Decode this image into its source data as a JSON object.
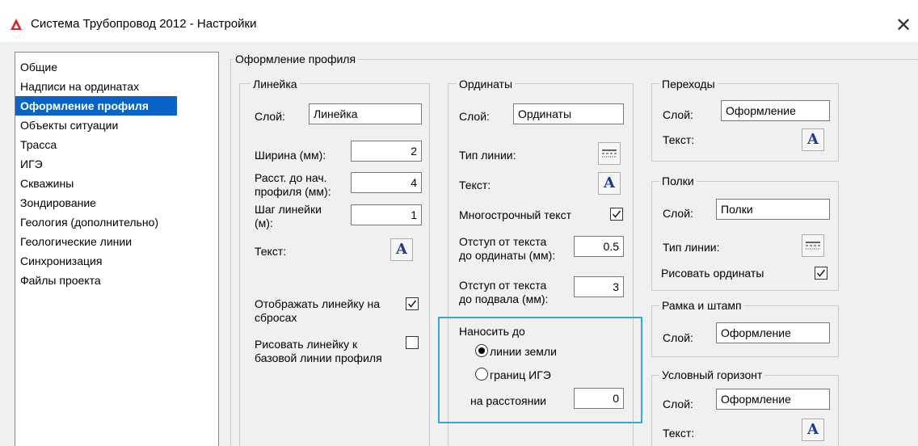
{
  "window": {
    "title": "Система Трубопровод 2012 - Настройки",
    "close_symbol": "✕"
  },
  "sidebar": {
    "items": [
      {
        "label": "Общие"
      },
      {
        "label": "Надписи на ординатах"
      },
      {
        "label": "Оформление профиля",
        "selected": true
      },
      {
        "label": "Объекты ситуации"
      },
      {
        "label": "Трасса"
      },
      {
        "label": "ИГЭ"
      },
      {
        "label": "Скважины"
      },
      {
        "label": "Зондирование"
      },
      {
        "label": "Геология (дополнительно)"
      },
      {
        "label": "Геологические линии"
      },
      {
        "label": "Синхронизация"
      },
      {
        "label": "Файлы проекта"
      }
    ]
  },
  "main": {
    "group_label": "Оформление профиля",
    "lineyka": {
      "label": "Линейка",
      "layer_label": "Слой:",
      "layer_value": "Линейка",
      "width_label": "Ширина (мм):",
      "width_value": "2",
      "dist_label_1": "Расст. до нач.",
      "dist_label_2": "профиля (мм):",
      "dist_value": "4",
      "step_label_1": "Шаг линейки",
      "step_label_2": "(м):",
      "step_value": "1",
      "text_label": "Текст:",
      "text_button": "A",
      "show_label_1": "Отображать линейку на",
      "show_label_2": "сбросах",
      "show_checked": true,
      "draw_label_1": "Рисовать линейку к",
      "draw_label_2": "базовой линии профиля",
      "draw_checked": false
    },
    "ordinaty": {
      "label": "Ординаты",
      "layer_label": "Слой:",
      "layer_value": "Ординаты",
      "linetype_label": "Тип линии:",
      "text_label": "Текст:",
      "text_button": "A",
      "multiline_label": "Многострочный текст",
      "multiline_checked": true,
      "offset_text_label_1": "Отступ от текста",
      "offset_text_label_2": "до ординаты (мм):",
      "offset_text_value": "0.5",
      "offset_base_label_1": "Отступ от текста",
      "offset_base_label_2": "до подвала (мм):",
      "offset_base_value": "3",
      "apply_to_label": "Наносить до",
      "radio_ground": "линии земли",
      "ground_selected": true,
      "radio_ige": "границ ИГЭ",
      "distance_label": "на расстоянии",
      "distance_value": "0"
    },
    "perehody": {
      "label": "Переходы",
      "layer_label": "Слой:",
      "layer_value": "Оформление",
      "text_label": "Текст:",
      "text_button": "A"
    },
    "polki": {
      "label": "Полки",
      "layer_label": "Слой:",
      "layer_value": "Полки",
      "linetype_label": "Тип линии:",
      "draw_ord_label": "Рисовать ординаты",
      "draw_ord_checked": true
    },
    "ramka": {
      "label": "Рамка и штамп",
      "layer_label": "Слой:",
      "layer_value": "Оформление"
    },
    "horizon": {
      "label": "Условный горизонт",
      "layer_label": "Слой:",
      "layer_value": "Оформление",
      "text_label": "Текст:",
      "text_button": "A"
    }
  }
}
